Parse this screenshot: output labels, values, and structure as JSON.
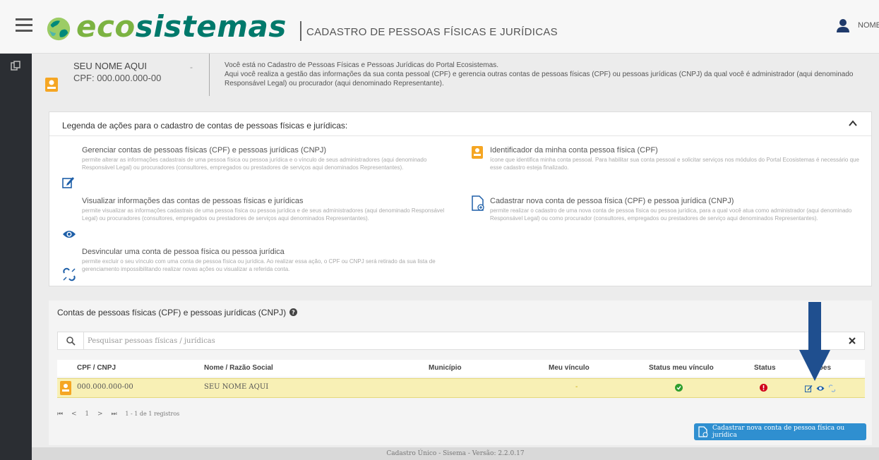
{
  "header": {
    "logo_eco": "eco",
    "logo_sistemas": "sistemas",
    "app_title": "CADASTRO DE PESSOAS FÍSICAS E JURÍDICAS",
    "user_name": "NOME"
  },
  "profile": {
    "name": "SEU NOME AQUI",
    "cpf": "CPF: 000.000.000-00",
    "dash": "-",
    "intro_line1": "Você está no Cadastro de Pessoas Físicas e Pessoas Jurídicas do Portal Ecosistemas.",
    "intro_line2": "Aqui você realiza a gestão das informações da sua conta pessoal (CPF) e gerencia outras contas de pessoas físicas (CPF) ou pessoas jurídicas (CNPJ) da qual você é administrador (aqui denominado Responsável Legal) ou procurador (aqui denominado Representante)."
  },
  "legend": {
    "title": "Legenda de ações para o cadastro de contas de pessoas físicas e jurídicas:",
    "items": [
      {
        "icon": "edit-icon",
        "title": "Gerenciar contas de pessoas físicas (CPF) e pessoas jurídicas (CNPJ)",
        "desc": "permite alterar as informações cadastrais de uma pessoa física ou pessoa jurídica e o vínculo de seus administradores (aqui denominado Responsável Legal) ou procuradores (consultores, empregados ou prestadores de serviços aqui denominados Representantes)."
      },
      {
        "icon": "eye-icon",
        "title": "Visualizar informações das contas de pessoas físicas e jurídicas",
        "desc": "permite visualizar as informações cadastrais de uma pessoa física ou pessoa jurídica e de seus administradores (aqui denominado Responsável Legal) ou procuradores (consultores, empregados ou prestadores de serviços aqui denominados Representantes)."
      },
      {
        "icon": "unlink-icon",
        "title": "Desvincular uma conta de pessoa física ou pessoa jurídica",
        "desc": "permite excluir o seu vínculo com uma conta de pessoa física ou jurídica. Ao realizar essa ação, o CPF ou CNPJ será retirado da sua lista de gerenciamento impossibilitando realizar novas ações ou visualizar a referida conta."
      },
      {
        "icon": "id-badge-icon",
        "title": "Identificador da minha conta pessoa física (CPF)",
        "desc": "ícone que identifica minha conta pessoal. Para habilitar sua conta pessoal e solicitar serviços nos módulos do Portal Ecosistemas é necessário que esse cadastro esteja finalizado."
      },
      {
        "icon": "new-document-icon",
        "title": "Cadastrar nova conta de pessoa física (CPF) e pessoa jurídica (CNPJ)",
        "desc": "permite realizar o cadastro de uma nova conta de pessoa física ou pessoa jurídica, para a qual você atua como administrador (aqui denominado Responsável Legal) ou como procurador (consultores, empregados ou prestadores de serviço aqui denominados Representantes)."
      }
    ]
  },
  "accounts": {
    "title": "Contas de pessoas físicas (CPF) e pessoas jurídicas (CNPJ)",
    "search_placeholder": "Pesquisar pessoas físicas / jurídicas",
    "columns": [
      "CPF / CNPJ",
      "Nome / Razão Social",
      "Município",
      "Meu vínculo",
      "Status meu vínculo",
      "Status",
      "Ações"
    ],
    "rows": [
      {
        "cpf_cnpj": "000.000.000-00",
        "nome": "SEU NOME AQUI",
        "municipio": "",
        "vinculo": "-"
      }
    ],
    "pager": {
      "first": "⏮",
      "prev": "<",
      "page": "1",
      "next": ">",
      "last": "⏭",
      "info": "1 - 1 de 1 registros"
    },
    "add_button": "Cadastrar nova conta de pessoa física ou jurídica"
  },
  "footer": "Cadastro Único - Sisema - Versão: 2.2.0.17",
  "colors": {
    "sidebar": "#2b2e33",
    "badge_orange": "#f5a623",
    "eco_green": "#7cb342",
    "sistemas_teal": "#00796b",
    "highlight_row": "#f8f0b5",
    "status_ok": "#2e9e2e",
    "status_alert": "#d0021b",
    "primary_button": "#2f8fd0",
    "arrow": "#1f4f8f"
  }
}
